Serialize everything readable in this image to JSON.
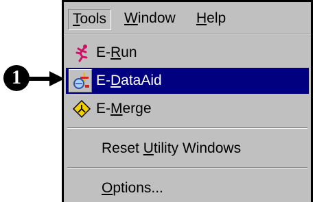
{
  "callout": {
    "number": "1"
  },
  "menubar": {
    "items": [
      {
        "pre": "",
        "mnemonic": "T",
        "post": "ools"
      },
      {
        "pre": "",
        "mnemonic": "W",
        "post": "indow"
      },
      {
        "pre": "",
        "mnemonic": "H",
        "post": "elp"
      }
    ]
  },
  "menu": {
    "items": [
      {
        "pre": "E-",
        "mnemonic": "R",
        "post": "un",
        "icon": "running-figure-icon"
      },
      {
        "pre": "E-",
        "mnemonic": "D",
        "post": "ataAid",
        "icon": "dataaid-icon",
        "selected": true
      },
      {
        "pre": "E-",
        "mnemonic": "M",
        "post": "erge",
        "icon": "merge-diamond-icon"
      },
      {
        "pre": "Reset ",
        "mnemonic": "U",
        "post": "tility Windows"
      },
      {
        "pre": "",
        "mnemonic": "O",
        "post": "ptions..."
      }
    ]
  },
  "colors": {
    "menu_bg": "#c0c0c0",
    "highlight": "#000080",
    "highlight_text": "#ffffff",
    "run_icon": "#cc1166",
    "merge_icon": "#f2d000"
  }
}
